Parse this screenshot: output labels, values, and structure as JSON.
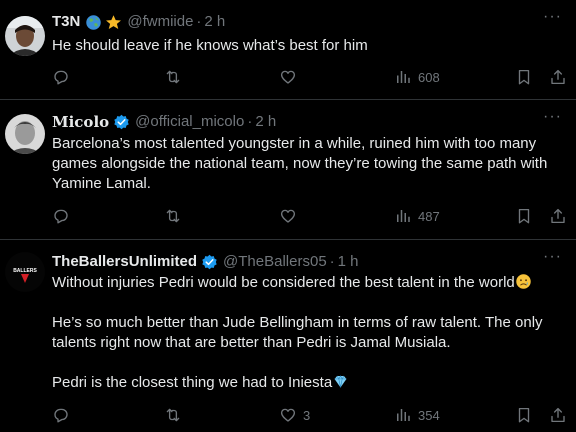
{
  "tweets": [
    {
      "name": "T3N",
      "handle": "@fwmiide",
      "time": "2 h",
      "lines": [
        "He should leave if he knows what’s best for him"
      ],
      "replies": "",
      "retweets": "",
      "likes": "",
      "views": "608",
      "verified": false,
      "badges": [
        "globe-emoji",
        "star-emoji"
      ]
    },
    {
      "name": "Micolo",
      "handle": "@official_micolo",
      "time": "2 h",
      "lines": [
        "Barcelona’s most talented youngster in a while, ruined him with too many",
        "games alongside the national team, now they’re towing the same path with",
        "Yamine Lamal."
      ],
      "replies": "",
      "retweets": "",
      "likes": "",
      "views": "487",
      "verified": true
    },
    {
      "name": "TheBallersUnlimited",
      "handle": "@TheBallers05",
      "time": "1 h",
      "paragraphs": [
        "Without injuries Pedri would be considered the best talent in the world",
        "He’s so much better than Jude Bellingham in terms of raw talent. The only",
        "talents right now that are better than Pedri is Jamal Musiala.",
        "Pedri is the closest thing we had to Iniesta"
      ],
      "avatar_text": "BALLERS",
      "replies": "",
      "retweets": "",
      "likes": "3",
      "views": "354",
      "verified": true
    }
  ],
  "separator": "·",
  "more_glyph": "···",
  "colors": {
    "verified": "#1d9bf0",
    "muted": "#71767b",
    "text": "#e7e9ea",
    "divider": "#2f3336"
  }
}
